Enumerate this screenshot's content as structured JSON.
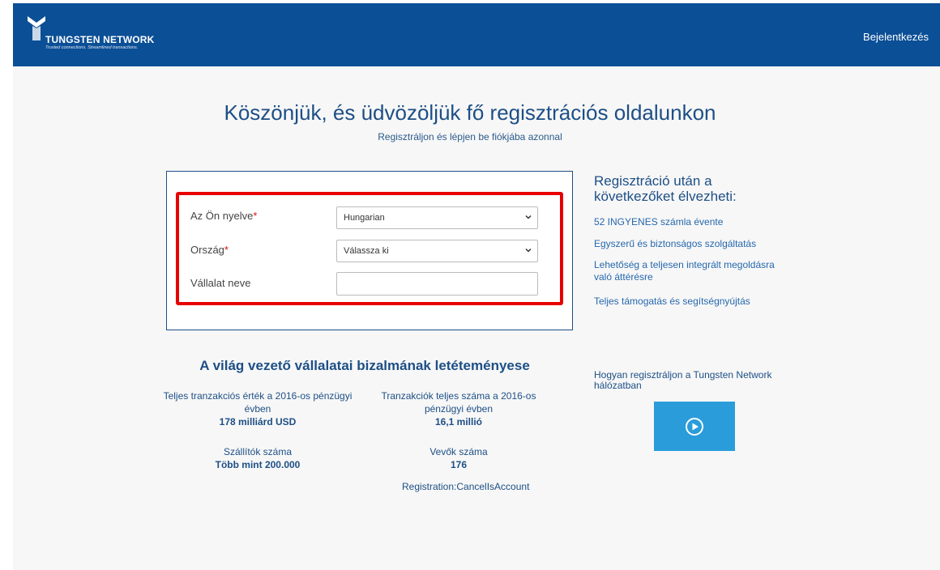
{
  "header": {
    "brand_name": "TUNGSTEN NETWORK",
    "brand_tagline": "Trusted connections. Streamlined transactions.",
    "login_label": "Bejelentkezés"
  },
  "hero": {
    "title": "Köszönjük, és üdvözöljük fő regisztrációs oldalunkon",
    "subtitle": "Regisztráljon és lépjen be fiókjába azonnal"
  },
  "form": {
    "language": {
      "label": "Az Ön nyelve",
      "required": "*",
      "value": "Hungarian"
    },
    "country": {
      "label": "Ország",
      "required": "*",
      "value": "Válassza ki"
    },
    "company": {
      "label": "Vállalat neve",
      "value": ""
    }
  },
  "benefits": {
    "title": "Regisztráció után a következőket élvezheti:",
    "items": [
      "52 INGYENES számla évente",
      "Egyszerű és biztonságos szolgáltatás",
      "Lehetőség a teljesen integrált megoldásra való áttérésre",
      "Teljes támogatás és segítségnyújtás"
    ]
  },
  "trust": {
    "title": "A világ vezető vállalatai bizalmának letéteményese",
    "stats": [
      {
        "label": "Teljes tranzakciós érték a 2016-os pénzügyi évben",
        "value": "178 milliárd USD"
      },
      {
        "label": "Tranzakciók teljes száma a 2016-os pénzügyi évben",
        "value": "16,1 millió"
      },
      {
        "label": "Szállítók száma",
        "value": "Több mint 200.000"
      },
      {
        "label": "Vevők száma",
        "value": "176"
      }
    ],
    "footer_text": "Registration:CancelIsAccount"
  },
  "video": {
    "title": "Hogyan regisztráljon a Tungsten Network hálózatban",
    "icon": "play-icon"
  },
  "colors": {
    "header_bg": "#0b4f96",
    "accent": "#1d4f86",
    "highlight_border": "#e80000",
    "video_bg": "#2a9cda"
  }
}
